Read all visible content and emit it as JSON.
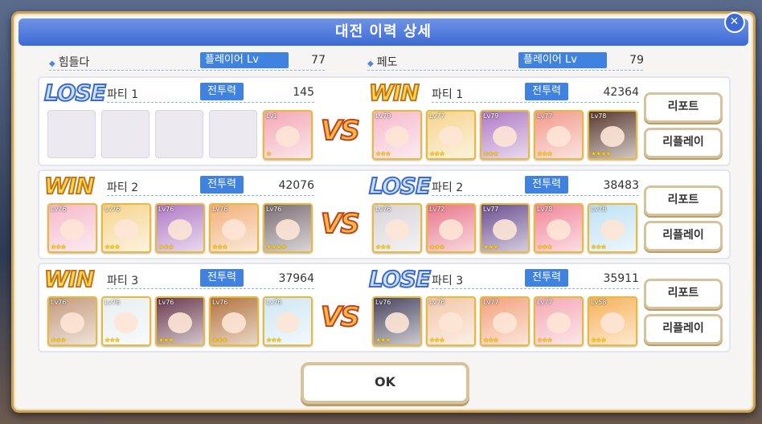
{
  "dialog": {
    "title": "대전 이력 상세",
    "ok_label": "OK"
  },
  "players": {
    "left": {
      "name": "힘들다",
      "level_label": "플레이어 Lv",
      "level": "77"
    },
    "right": {
      "name": "페도",
      "level_label": "플레이어 Lv",
      "level": "79"
    }
  },
  "power_label": "전투력",
  "buttons": {
    "report": "리포트",
    "replay": "리플레이"
  },
  "vs": "VS",
  "parties": [
    {
      "left": {
        "result": "LOSE",
        "name": "파티 1",
        "power": "145",
        "units": [
          null,
          null,
          null,
          null,
          {
            "lv": "Lv1",
            "stars": "★",
            "color": "#f3a7b6"
          }
        ]
      },
      "right": {
        "result": "WIN",
        "name": "파티 1",
        "power": "42364",
        "units": [
          {
            "lv": "Lv79",
            "stars": "★★★",
            "color": "#f6b9cc"
          },
          {
            "lv": "Lv77",
            "stars": "★★★",
            "color": "#f6d48d"
          },
          {
            "lv": "Lv79",
            "stars": "★★★",
            "color": "#b07ac5"
          },
          {
            "lv": "Lv77",
            "stars": "★★★",
            "color": "#f29a8c"
          },
          {
            "lv": "Lv78",
            "stars": "★★★★",
            "color": "#5a3a30"
          }
        ]
      }
    },
    {
      "left": {
        "result": "WIN",
        "name": "파티 2",
        "power": "42076",
        "units": [
          {
            "lv": "Lv76",
            "stars": "★★★",
            "color": "#f6b9cc"
          },
          {
            "lv": "Lv76",
            "stars": "★★★",
            "color": "#f6d48d"
          },
          {
            "lv": "Lv76",
            "stars": "★★★",
            "color": "#b07ac5"
          },
          {
            "lv": "Lv76",
            "stars": "★★★",
            "color": "#f2b07a"
          },
          {
            "lv": "Lv76",
            "stars": "★★★★",
            "color": "#7b6e74"
          }
        ]
      },
      "right": {
        "result": "LOSE",
        "name": "파티 2",
        "power": "38483",
        "units": [
          {
            "lv": "Lv76",
            "stars": "★★★",
            "color": "#d9d3d8"
          },
          {
            "lv": "Lv72",
            "stars": "★★★",
            "color": "#e9778a"
          },
          {
            "lv": "Lv77",
            "stars": "★★★",
            "color": "#6a4f8f"
          },
          {
            "lv": "Lv78",
            "stars": "★★★",
            "color": "#f2879a"
          },
          {
            "lv": "Lv78",
            "stars": "★★★",
            "color": "#bfe1f5"
          }
        ]
      }
    },
    {
      "left": {
        "result": "WIN",
        "name": "파티 3",
        "power": "37964",
        "units": [
          {
            "lv": "Lv76",
            "stars": "★★★",
            "color": "#c59a7c"
          },
          {
            "lv": "Lv76",
            "stars": "★★★",
            "color": "#e8eef0"
          },
          {
            "lv": "Lv76",
            "stars": "★★★",
            "color": "#6a3a4e"
          },
          {
            "lv": "Lv76",
            "stars": "★★★",
            "color": "#b3733e"
          },
          {
            "lv": "Lv76",
            "stars": "★★★",
            "color": "#cfe7f4"
          }
        ]
      },
      "right": {
        "result": "LOSE",
        "name": "파티 3",
        "power": "35911",
        "units": [
          {
            "lv": "Lv76",
            "stars": "★★★",
            "color": "#4a4560"
          },
          {
            "lv": "Lv76",
            "stars": "★★★",
            "color": "#f3c7a8"
          },
          {
            "lv": "Lv77",
            "stars": "★★★",
            "color": "#f3a27e"
          },
          {
            "lv": "Lv77",
            "stars": "★★★",
            "color": "#f4a8b4"
          },
          {
            "lv": "Lv58",
            "stars": "★★★",
            "color": "#f7b25a"
          }
        ]
      }
    }
  ]
}
